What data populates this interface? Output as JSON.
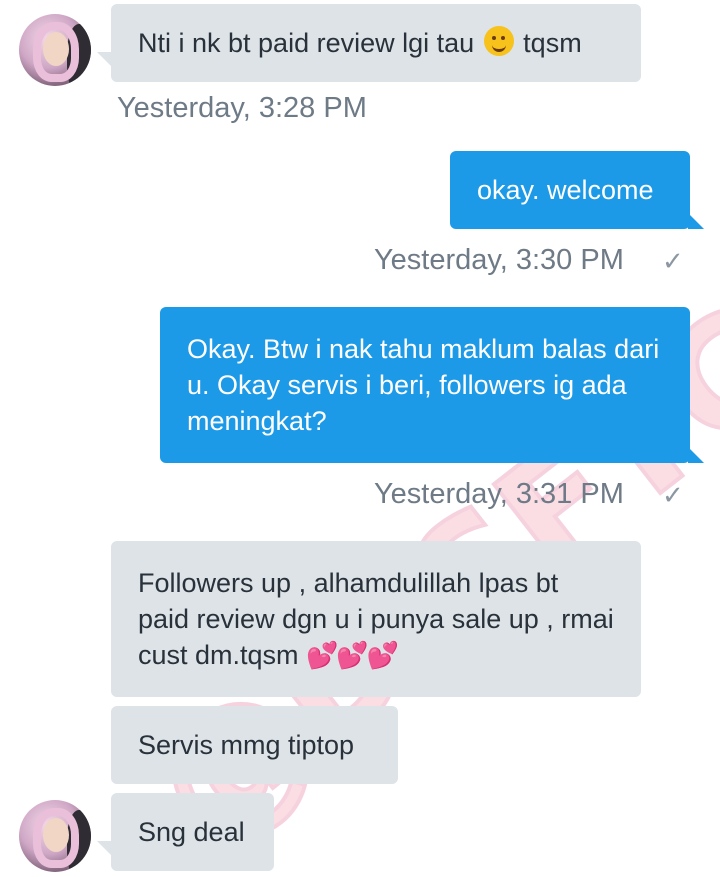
{
  "watermark": {
    "text": "@DISFTC"
  },
  "messages": [
    {
      "direction": "incoming",
      "text_before_emoji": "Nti i nk bt paid review lgi tau ",
      "emoji": "smiling-face-emoji",
      "text_after_emoji": " tqsm",
      "time": "Yesterday, 3:28 PM"
    },
    {
      "direction": "outgoing",
      "text": "okay. welcome",
      "time": "Yesterday, 3:30 PM",
      "status": "✓"
    },
    {
      "direction": "outgoing",
      "text": "Okay. Btw i nak tahu maklum balas dari u. Okay servis i beri, followers ig ada meningkat?",
      "time": "Yesterday, 3:31 PM",
      "status": "✓"
    },
    {
      "direction": "incoming",
      "text": "Followers up , alhamdulillah lpas bt paid review dgn u i punya sale up , rmai cust dm.tqsm",
      "emoji": "pink-hearts-emoji"
    },
    {
      "direction": "incoming",
      "text": "Servis mmg tiptop"
    },
    {
      "direction": "incoming",
      "text": "Sng deal"
    }
  ],
  "colors": {
    "incoming_bubble": "#dde3e7",
    "outgoing_bubble": "#1d9ae7",
    "timestamp": "#6e7a86"
  }
}
